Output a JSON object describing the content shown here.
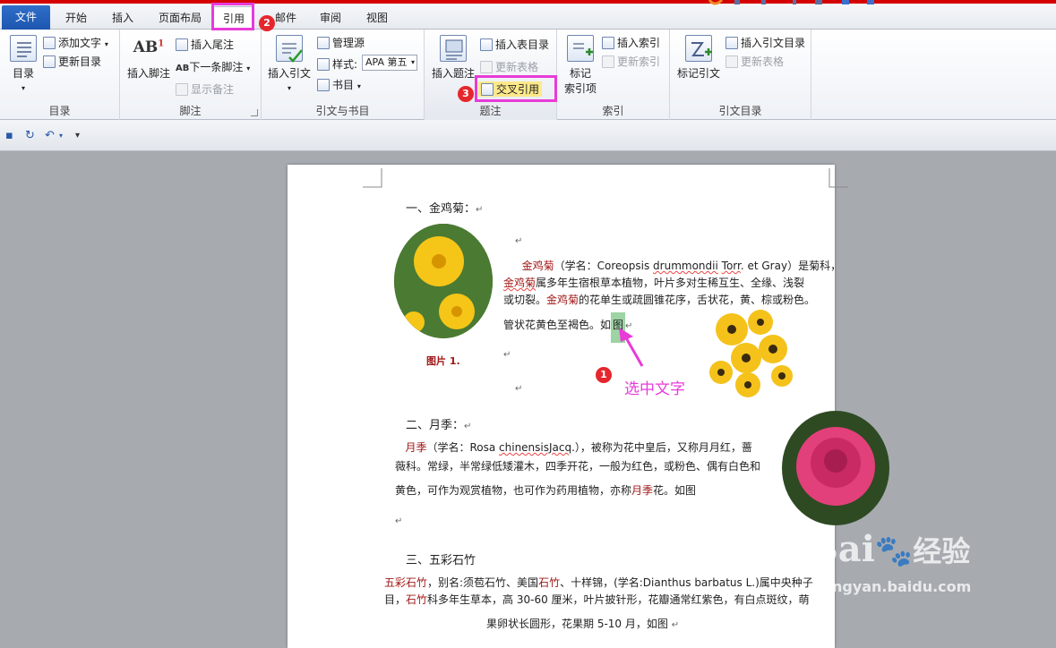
{
  "tabs": [
    "文件",
    "开始",
    "插入",
    "页面布局",
    "引用",
    "邮件",
    "审阅",
    "视图"
  ],
  "active_tab": "引用",
  "ribbon": {
    "toc": {
      "label": "目录",
      "add_text": "添加文字",
      "update_toc": "更新目录",
      "group": "目录"
    },
    "footnotes": {
      "insert_footnote": "插入脚注",
      "insert_endnote": "插入尾注",
      "next_footnote": "下一条脚注",
      "show_notes": "显示备注",
      "group": "脚注"
    },
    "citations": {
      "insert_citation": "插入引文",
      "manage_sources": "管理源",
      "style_label": "样式:",
      "style_value": "APA 第五",
      "bibliography": "书目",
      "group": "引文与书目"
    },
    "captions": {
      "insert_caption": "插入题注",
      "insert_table_figures": "插入表目录",
      "update_table": "更新表格",
      "cross_reference": "交叉引用",
      "group": "题注"
    },
    "index": {
      "mark_entry_1": "标记",
      "mark_entry_2": "索引项",
      "insert_index": "插入索引",
      "update_index": "更新索引",
      "group": "索引"
    },
    "authorities": {
      "mark_citation": "标记引文",
      "insert_toa": "插入引文目录",
      "update_table": "更新表格",
      "group": "引文目录"
    }
  },
  "annotations": {
    "step1": "1",
    "step2": "2",
    "step3": "3",
    "select_text": "选中文字"
  },
  "document": {
    "s1_heading": "一、金鸡菊：",
    "s1_l1a": "金鸡菊",
    "s1_l1b": "（学名：Coreopsis ",
    "s1_l1c": "drummondii",
    "s1_l1d": " ",
    "s1_l1e": "Torr",
    "s1_l1f": ". et Gray）是菊科，",
    "s1_l2a": "金鸡菊",
    "s1_l2b": "属多年生宿根草本植物，叶片多对生稀互生、全缘、浅裂",
    "s1_l3a": "或切裂。",
    "s1_l3b": "金鸡菊",
    "s1_l3c": "的花单生或疏圆锥花序，舌状花，黄、棕或粉色。",
    "s1_l4a": "管状花黄色至褐色。如",
    "s1_l4b": "图",
    "s1_caption": "图片 1.",
    "s2_heading": "二、月季：",
    "s2_l1a": "月季",
    "s2_l1b": "（学名：Rosa ",
    "s2_l1c": "chinensisJacq",
    "s2_l1d": ".），被称为花中皇后，又称月月红，蔷",
    "s2_l2": "薇科。常绿，半常绿低矮灌木，四季开花，一般为红色，或粉色、偶有白色和",
    "s2_l3a": "黄色，可作为观赏植物，也可作为药用植物，亦称",
    "s2_l3b": "月季",
    "s2_l3c": "花。如图",
    "s3_heading": "三、五彩石竹",
    "s3_l1a": "五彩石竹",
    "s3_l1b": "，别名:须苞石竹、美国",
    "s3_l1c": "石竹",
    "s3_l1d": "、十样锦，(学名:Dianthus barbatus L.)属中央种子",
    "s3_l2a": "目，",
    "s3_l2b": "石竹",
    "s3_l2c": "科多年生草本，高 30-60 厘米，叶片披针形，花瓣通常红紫色，有白点斑纹，萌",
    "s3_l3": "果卵状长圆形，花果期 5-10 月，如图"
  },
  "watermark": {
    "main": "Bai",
    "cn": "经验",
    "url": "jingyan.baidu.com"
  },
  "colors": {
    "highlight": "#e83bd8",
    "file_tab": "#1d56b0",
    "selection": "#9ed3a4"
  }
}
